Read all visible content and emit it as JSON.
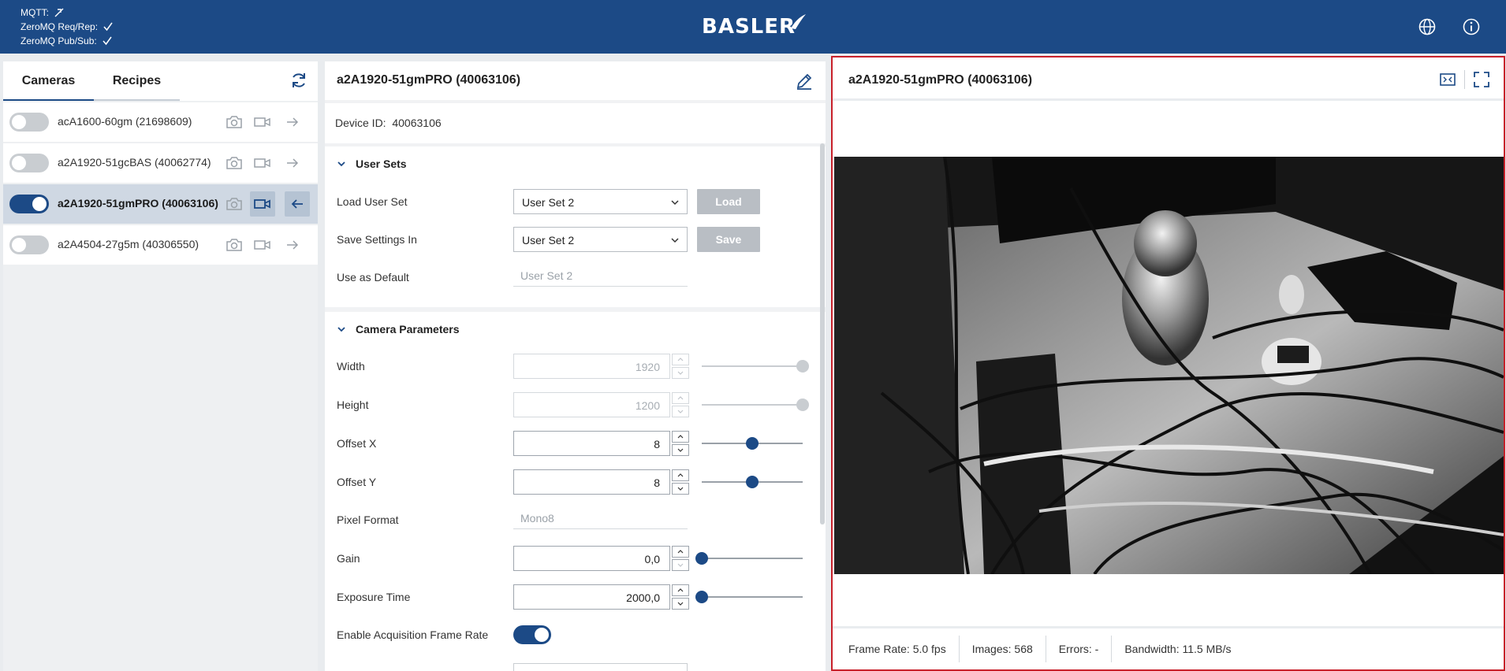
{
  "connection": {
    "mqtt_label": "MQTT:",
    "zmq_reqrep_label": "ZeroMQ Req/Rep:",
    "zmq_pubsub_label": "ZeroMQ Pub/Sub:"
  },
  "brand": {
    "logo_text": "BASLER"
  },
  "left_panel": {
    "tabs": [
      {
        "label": "Cameras"
      },
      {
        "label": "Recipes"
      }
    ],
    "cameras": [
      {
        "label": "acA1600-60gm (21698609)",
        "enabled": false
      },
      {
        "label": "a2A1920-51gcBAS (40062774)",
        "enabled": false
      },
      {
        "label": "a2A1920-51gmPRO (40063106)",
        "enabled": true
      },
      {
        "label": "a2A4504-27g5m (40306550)",
        "enabled": false
      }
    ]
  },
  "middle_panel": {
    "title": "a2A1920-51gmPRO (40063106)",
    "device_id_label": "Device ID:",
    "device_id_value": "40063106",
    "user_sets": {
      "title": "User Sets",
      "load_label": "Load User Set",
      "load_value": "User Set 2",
      "load_button": "Load",
      "save_label": "Save Settings In",
      "save_value": "User Set 2",
      "save_button": "Save",
      "default_label": "Use as Default",
      "default_value": "User Set 2"
    },
    "camera_parameters": {
      "title": "Camera Parameters",
      "width_label": "Width",
      "width_value": "1920",
      "width_level": 1.0,
      "height_label": "Height",
      "height_value": "1200",
      "height_level": 1.0,
      "offset_x_label": "Offset X",
      "offset_x_value": "8",
      "offset_x_level": 0.5,
      "offset_y_label": "Offset Y",
      "offset_y_value": "8",
      "offset_y_level": 0.5,
      "pixel_format_label": "Pixel Format",
      "pixel_format_value": "Mono8",
      "gain_label": "Gain",
      "gain_value": "0,0",
      "gain_level": 0.0,
      "exposure_label": "Exposure Time",
      "exposure_value": "2000,0",
      "exposure_level": 0.0,
      "frame_rate_enable_label": "Enable Acquisition Frame Rate",
      "frame_rate_enabled": true
    }
  },
  "right_panel": {
    "title": "a2A1920-51gmPRO (40063106)",
    "status": {
      "frame_rate": "Frame Rate: 5.0 fps",
      "images": "Images: 568",
      "errors": "Errors: -",
      "bandwidth": "Bandwidth: 11.5 MB/s"
    }
  },
  "colors": {
    "brand_blue": "#1c4a86",
    "highlight_red": "#c8202a"
  }
}
